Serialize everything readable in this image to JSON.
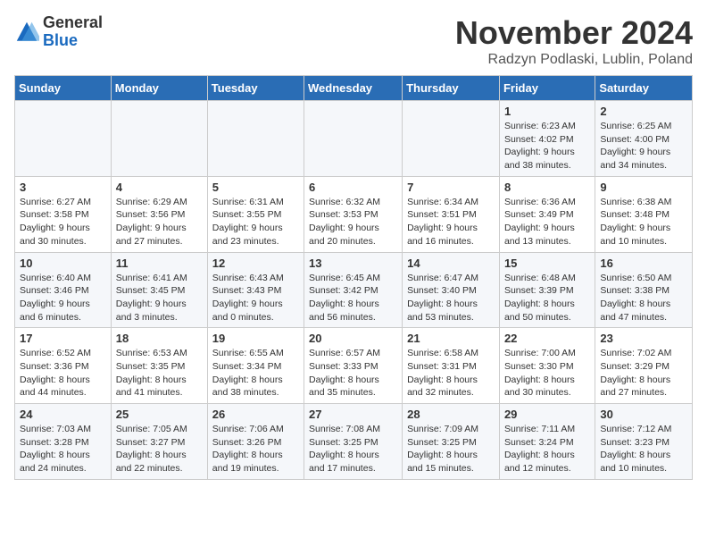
{
  "logo": {
    "general": "General",
    "blue": "Blue"
  },
  "title": "November 2024",
  "location": "Radzyn Podlaski, Lublin, Poland",
  "weekdays": [
    "Sunday",
    "Monday",
    "Tuesday",
    "Wednesday",
    "Thursday",
    "Friday",
    "Saturday"
  ],
  "weeks": [
    [
      {
        "day": "",
        "info": ""
      },
      {
        "day": "",
        "info": ""
      },
      {
        "day": "",
        "info": ""
      },
      {
        "day": "",
        "info": ""
      },
      {
        "day": "",
        "info": ""
      },
      {
        "day": "1",
        "info": "Sunrise: 6:23 AM\nSunset: 4:02 PM\nDaylight: 9 hours\nand 38 minutes."
      },
      {
        "day": "2",
        "info": "Sunrise: 6:25 AM\nSunset: 4:00 PM\nDaylight: 9 hours\nand 34 minutes."
      }
    ],
    [
      {
        "day": "3",
        "info": "Sunrise: 6:27 AM\nSunset: 3:58 PM\nDaylight: 9 hours\nand 30 minutes."
      },
      {
        "day": "4",
        "info": "Sunrise: 6:29 AM\nSunset: 3:56 PM\nDaylight: 9 hours\nand 27 minutes."
      },
      {
        "day": "5",
        "info": "Sunrise: 6:31 AM\nSunset: 3:55 PM\nDaylight: 9 hours\nand 23 minutes."
      },
      {
        "day": "6",
        "info": "Sunrise: 6:32 AM\nSunset: 3:53 PM\nDaylight: 9 hours\nand 20 minutes."
      },
      {
        "day": "7",
        "info": "Sunrise: 6:34 AM\nSunset: 3:51 PM\nDaylight: 9 hours\nand 16 minutes."
      },
      {
        "day": "8",
        "info": "Sunrise: 6:36 AM\nSunset: 3:49 PM\nDaylight: 9 hours\nand 13 minutes."
      },
      {
        "day": "9",
        "info": "Sunrise: 6:38 AM\nSunset: 3:48 PM\nDaylight: 9 hours\nand 10 minutes."
      }
    ],
    [
      {
        "day": "10",
        "info": "Sunrise: 6:40 AM\nSunset: 3:46 PM\nDaylight: 9 hours\nand 6 minutes."
      },
      {
        "day": "11",
        "info": "Sunrise: 6:41 AM\nSunset: 3:45 PM\nDaylight: 9 hours\nand 3 minutes."
      },
      {
        "day": "12",
        "info": "Sunrise: 6:43 AM\nSunset: 3:43 PM\nDaylight: 9 hours\nand 0 minutes."
      },
      {
        "day": "13",
        "info": "Sunrise: 6:45 AM\nSunset: 3:42 PM\nDaylight: 8 hours\nand 56 minutes."
      },
      {
        "day": "14",
        "info": "Sunrise: 6:47 AM\nSunset: 3:40 PM\nDaylight: 8 hours\nand 53 minutes."
      },
      {
        "day": "15",
        "info": "Sunrise: 6:48 AM\nSunset: 3:39 PM\nDaylight: 8 hours\nand 50 minutes."
      },
      {
        "day": "16",
        "info": "Sunrise: 6:50 AM\nSunset: 3:38 PM\nDaylight: 8 hours\nand 47 minutes."
      }
    ],
    [
      {
        "day": "17",
        "info": "Sunrise: 6:52 AM\nSunset: 3:36 PM\nDaylight: 8 hours\nand 44 minutes."
      },
      {
        "day": "18",
        "info": "Sunrise: 6:53 AM\nSunset: 3:35 PM\nDaylight: 8 hours\nand 41 minutes."
      },
      {
        "day": "19",
        "info": "Sunrise: 6:55 AM\nSunset: 3:34 PM\nDaylight: 8 hours\nand 38 minutes."
      },
      {
        "day": "20",
        "info": "Sunrise: 6:57 AM\nSunset: 3:33 PM\nDaylight: 8 hours\nand 35 minutes."
      },
      {
        "day": "21",
        "info": "Sunrise: 6:58 AM\nSunset: 3:31 PM\nDaylight: 8 hours\nand 32 minutes."
      },
      {
        "day": "22",
        "info": "Sunrise: 7:00 AM\nSunset: 3:30 PM\nDaylight: 8 hours\nand 30 minutes."
      },
      {
        "day": "23",
        "info": "Sunrise: 7:02 AM\nSunset: 3:29 PM\nDaylight: 8 hours\nand 27 minutes."
      }
    ],
    [
      {
        "day": "24",
        "info": "Sunrise: 7:03 AM\nSunset: 3:28 PM\nDaylight: 8 hours\nand 24 minutes."
      },
      {
        "day": "25",
        "info": "Sunrise: 7:05 AM\nSunset: 3:27 PM\nDaylight: 8 hours\nand 22 minutes."
      },
      {
        "day": "26",
        "info": "Sunrise: 7:06 AM\nSunset: 3:26 PM\nDaylight: 8 hours\nand 19 minutes."
      },
      {
        "day": "27",
        "info": "Sunrise: 7:08 AM\nSunset: 3:25 PM\nDaylight: 8 hours\nand 17 minutes."
      },
      {
        "day": "28",
        "info": "Sunrise: 7:09 AM\nSunset: 3:25 PM\nDaylight: 8 hours\nand 15 minutes."
      },
      {
        "day": "29",
        "info": "Sunrise: 7:11 AM\nSunset: 3:24 PM\nDaylight: 8 hours\nand 12 minutes."
      },
      {
        "day": "30",
        "info": "Sunrise: 7:12 AM\nSunset: 3:23 PM\nDaylight: 8 hours\nand 10 minutes."
      }
    ]
  ]
}
